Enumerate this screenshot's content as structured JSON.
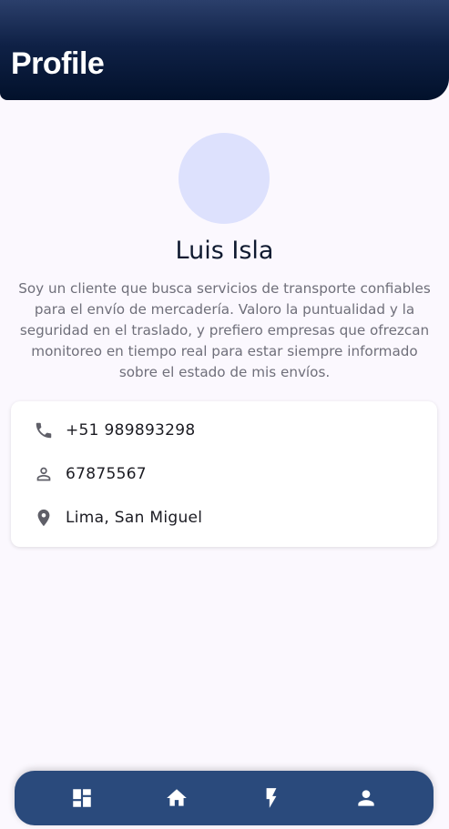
{
  "header": {
    "title": "Profile"
  },
  "profile": {
    "name": "Luis Isla",
    "bio": "Soy un cliente que busca servicios de transporte confiables para el envío de mercadería. Valoro la puntualidad y la seguridad en el traslado, y prefiero empresas que ofrezcan monitoreo en tiempo real para estar siempre informado sobre el estado de mis envíos."
  },
  "info": {
    "phone": {
      "icon": "phone-icon",
      "value": "+51 989893298"
    },
    "id": {
      "icon": "person-outline-icon",
      "value": "67875567"
    },
    "location": {
      "icon": "location-pin-icon",
      "value": "Lima, San Miguel"
    }
  },
  "nav": {
    "items": [
      {
        "icon": "dashboard-icon"
      },
      {
        "icon": "home-icon"
      },
      {
        "icon": "lightning-icon"
      },
      {
        "icon": "person-icon"
      }
    ]
  },
  "colors": {
    "header_top": "#2b3f6b",
    "header_bottom": "#02112b",
    "avatar": "#dde1fd",
    "nav_background": "#2a4a7c",
    "page_background": "#fbf8fe"
  }
}
